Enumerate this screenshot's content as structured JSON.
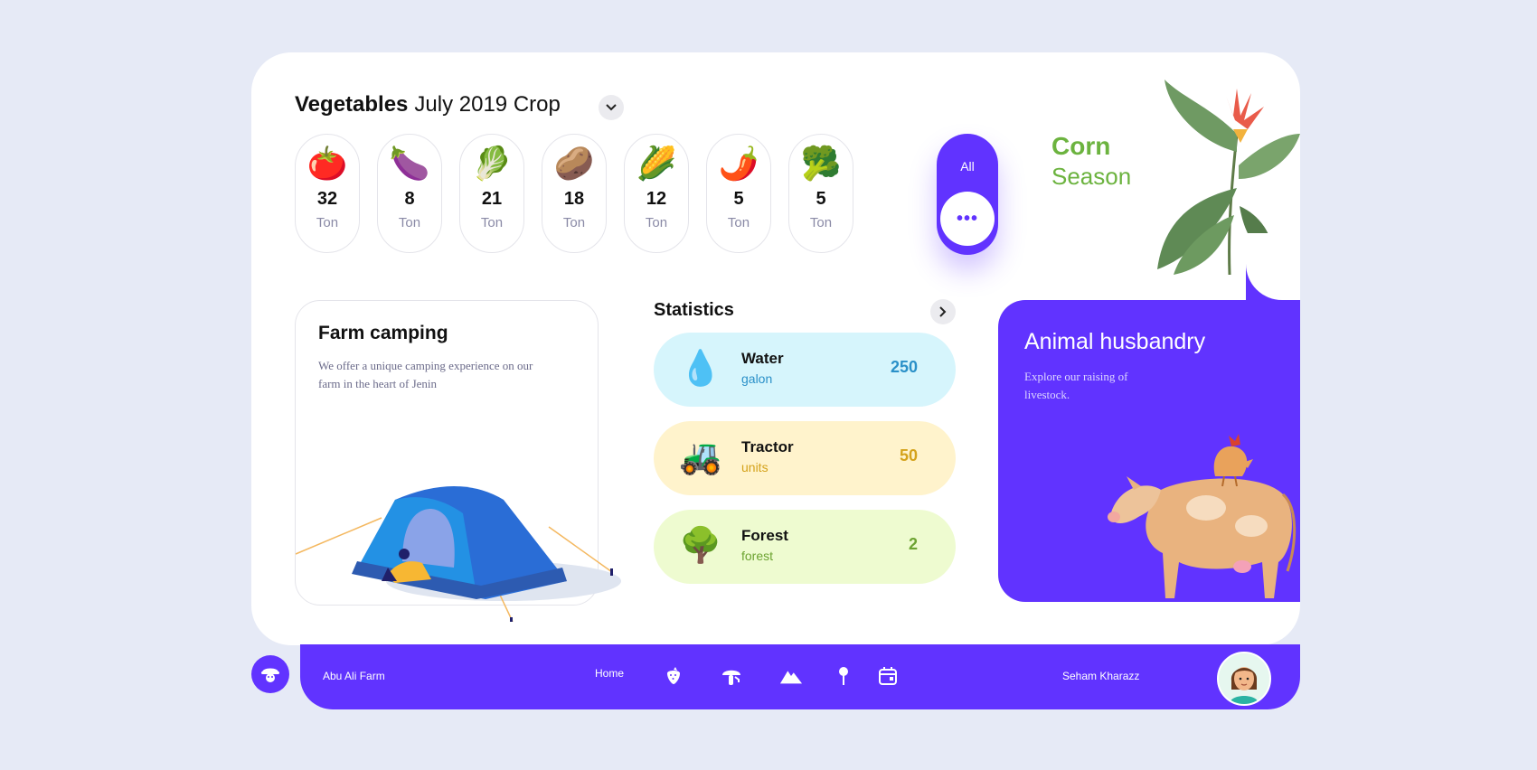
{
  "header": {
    "title_bold": "Vegetables",
    "title_rest": "July 2019 Crop"
  },
  "vegetables": [
    {
      "emoji": "🍅",
      "value": "32",
      "unit": "Ton",
      "icon": "tomato-icon"
    },
    {
      "emoji": "🍆",
      "value": "8",
      "unit": "Ton",
      "icon": "eggplant-icon"
    },
    {
      "emoji": "🥬",
      "value": "21",
      "unit": "Ton",
      "icon": "lettuce-icon"
    },
    {
      "emoji": "🥔",
      "value": "18",
      "unit": "Ton",
      "icon": "potato-icon"
    },
    {
      "emoji": "🌽",
      "value": "12",
      "unit": "Ton",
      "icon": "corn-icon"
    },
    {
      "emoji": "🌶️",
      "value": "5",
      "unit": "Ton",
      "icon": "chili-icon"
    },
    {
      "emoji": "🥦",
      "value": "5",
      "unit": "Ton",
      "icon": "broccoli-icon"
    }
  ],
  "filter": {
    "all_label": "All",
    "more_label": "•••"
  },
  "season": {
    "line1": "Corn",
    "line2": "Season"
  },
  "farm_camping": {
    "title": "Farm camping",
    "description": "We offer a unique camping experience on our farm in the heart of Jenin"
  },
  "statistics": {
    "title": "Statistics",
    "items": [
      {
        "icon": "💧",
        "name": "Water",
        "unit": "galon",
        "value": "250",
        "bg": "#d6f5fc",
        "color": "#2a90c8"
      },
      {
        "icon": "🚜",
        "name": "Tractor",
        "unit": "units",
        "value": "50",
        "bg": "#fff3cc",
        "color": "#d4a21b"
      },
      {
        "icon": "🌳",
        "name": "Forest",
        "unit": "forest",
        "value": "2",
        "bg": "#eefbd0",
        "color": "#6ca331"
      }
    ]
  },
  "animal": {
    "title": "Animal husbandry",
    "description": "Explore our raising of livestock."
  },
  "bottom": {
    "farm_name": "Abu Ali Farm",
    "home_label": "Home",
    "user_name": "Seham Kharazz"
  },
  "colors": {
    "accent": "#6133ff",
    "green": "#6cb33f",
    "background": "#e6eaf6"
  }
}
